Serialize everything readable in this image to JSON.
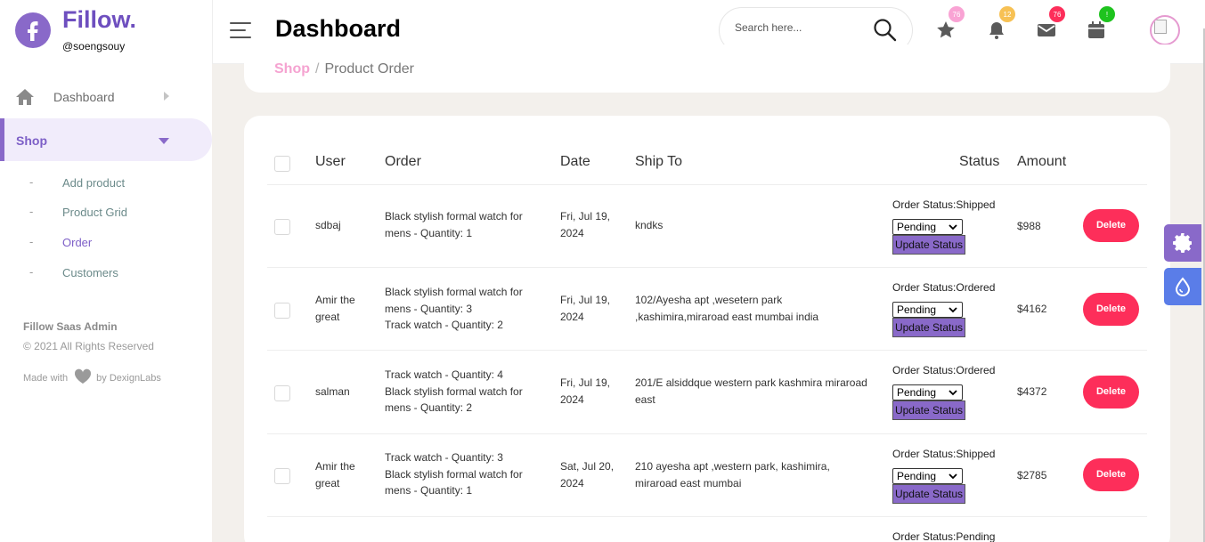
{
  "brand": {
    "name": "Fillow.",
    "username": "@soengsouy",
    "logo_letter": "f"
  },
  "sidebar": {
    "items": [
      {
        "label": "Dashboard",
        "icon": "home-icon"
      },
      {
        "label": "Shop",
        "icon": "chevron-down-icon",
        "active": true
      }
    ],
    "sub_items": [
      {
        "label": "Add product"
      },
      {
        "label": "Product Grid"
      },
      {
        "label": "Order",
        "active": true
      },
      {
        "label": "Customers"
      }
    ],
    "footer": {
      "title": "Fillow Saas Admin",
      "copyright": "© 2021 All Rights Reserved",
      "made_with": "Made with",
      "by": "by DexignLabs"
    }
  },
  "header": {
    "title": "Dashboard",
    "search_placeholder": "Search here...",
    "icons": [
      {
        "name": "star-icon",
        "badge": "76",
        "badge_color": "#f9a3d4"
      },
      {
        "name": "bell-icon",
        "badge": "12",
        "badge_color": "#f7c154"
      },
      {
        "name": "mail-icon",
        "badge": "76",
        "badge_color": "#fd2e5a"
      },
      {
        "name": "calendar-icon",
        "badge": "!",
        "badge_color": "#1ec31e"
      }
    ]
  },
  "breadcrumb": {
    "parent": "Shop",
    "separator": "/",
    "current": "Product Order"
  },
  "table": {
    "headers": {
      "user": "User",
      "order": "Order",
      "date": "Date",
      "ship_to": "Ship To",
      "status": "Status",
      "amount": "Amount"
    },
    "rows": [
      {
        "user": [
          "sdbaj"
        ],
        "order": [
          "Black stylish formal watch for",
          "mens - Quantity: 1"
        ],
        "date": [
          "Fri, Jul 19,",
          "2024"
        ],
        "ship_to": [
          "kndks"
        ],
        "status": "Order Status:Shipped",
        "select": "Pending",
        "update_label": "Update Status",
        "amount": "$988",
        "delete_label": "Delete"
      },
      {
        "user": [
          "Amir the",
          "great"
        ],
        "order": [
          "Black stylish formal watch for",
          "mens - Quantity: 3",
          "Track watch - Quantity: 2"
        ],
        "date": [
          "Fri, Jul 19,",
          "2024"
        ],
        "ship_to": [
          "102/Ayesha apt ,wesetern park",
          ",kashimira,miraroad east mumbai india"
        ],
        "status": "Order Status:Ordered",
        "select": "Pending",
        "update_label": "Update Status",
        "amount": "$4162",
        "delete_label": "Delete"
      },
      {
        "user": [
          "salman"
        ],
        "order": [
          "Track watch - Quantity: 4",
          "Black stylish formal watch for",
          "mens - Quantity: 2"
        ],
        "date": [
          "Fri, Jul 19,",
          "2024"
        ],
        "ship_to": [
          "201/E alsiddque western park kashmira miraroad",
          "east"
        ],
        "status": "Order Status:Ordered",
        "select": "Pending",
        "update_label": "Update Status",
        "amount": "$4372",
        "delete_label": "Delete"
      },
      {
        "user": [
          "Amir the",
          "great"
        ],
        "order": [
          "Track watch - Quantity: 3",
          "Black stylish formal watch for",
          "mens - Quantity: 1"
        ],
        "date": [
          "Sat, Jul 20,",
          "2024"
        ],
        "ship_to": [
          "210 ayesha apt ,western park, kashimira,",
          "miraroad east mumbai"
        ],
        "status": "Order Status:Shipped",
        "select": "Pending",
        "update_label": "Update Status",
        "amount": "$2785",
        "delete_label": "Delete"
      },
      {
        "status": "Order Status:Pending"
      }
    ]
  },
  "floating": [
    {
      "name": "settings-gear-icon",
      "color": "#8969c9"
    },
    {
      "name": "water-drop-icon",
      "color": "#5a7de8"
    }
  ]
}
